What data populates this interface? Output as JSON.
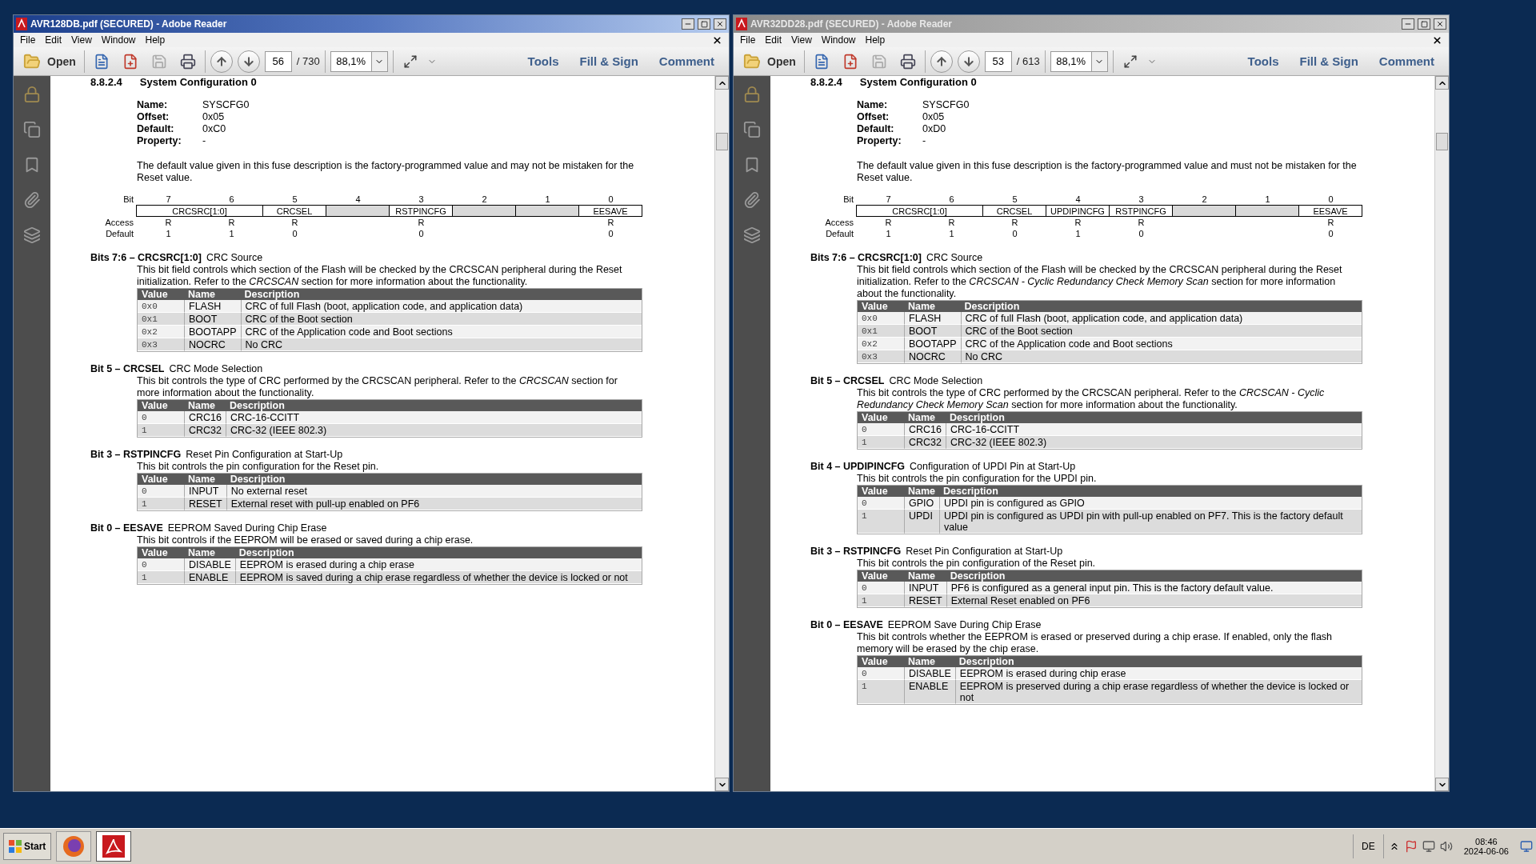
{
  "windows": [
    {
      "title": "AVR128DB.pdf (SECURED) - Adobe Reader",
      "active": true,
      "menu": [
        "File",
        "Edit",
        "View",
        "Window",
        "Help"
      ],
      "toolbar": {
        "open": "Open",
        "page": "56",
        "page_count": "/ 730",
        "zoom": "88,1%",
        "tools": "Tools",
        "fill_sign": "Fill & Sign",
        "comment": "Comment"
      },
      "document": {
        "section_number": "8.8.2.4",
        "section_title": "System Configuration 0",
        "properties": [
          {
            "label": "Name:",
            "value": "SYSCFG0"
          },
          {
            "label": "Offset:",
            "value": "0x05"
          },
          {
            "label": "Default:",
            "value": "0xC0"
          },
          {
            "label": "Property:",
            "value": "-"
          }
        ],
        "note": "The default value given in this fuse description is the factory-programmed value and may not be mistaken for the Reset value.",
        "register": {
          "bit_label": "Bit",
          "access_label": "Access",
          "default_label": "Default",
          "bits": [
            {
              "number": "7",
              "access": "R",
              "default": "1"
            },
            {
              "number": "6",
              "access": "R",
              "default": "1"
            },
            {
              "number": "5",
              "access": "R",
              "default": "0"
            },
            {
              "number": "4"
            },
            {
              "number": "3",
              "access": "R",
              "default": "0"
            },
            {
              "number": "2"
            },
            {
              "number": "1"
            },
            {
              "number": "0",
              "access": "R",
              "default": "0"
            }
          ],
          "fields": [
            {
              "kind": "field",
              "name": "CRCSRC[1:0]",
              "wide": true
            },
            {
              "kind": "field",
              "name": "CRCSEL",
              "wide": false
            },
            {
              "kind": "reserved",
              "wide": false
            },
            {
              "kind": "field",
              "name": "RSTPINCFG",
              "wide": false
            },
            {
              "kind": "reserved",
              "wide": false
            },
            {
              "kind": "reserved",
              "wide": false
            },
            {
              "kind": "field",
              "name": "EESAVE",
              "wide": false
            }
          ]
        },
        "sections": [
          {
            "label": "Bits 7:6 – CRCSRC[1:0]",
            "title": "CRC Source",
            "paragraph": "This bit field controls which section of the Flash will be checked by the CRCSCAN peripheral during the Reset initialization. Refer to the *CRCSCAN* section for more information about the functionality.",
            "columns": [
              "Value",
              "Name",
              "Description"
            ],
            "rows": [
              [
                "0x0",
                "FLASH",
                "CRC of full Flash (boot, application code, and application data)"
              ],
              [
                "0x1",
                "BOOT",
                "CRC of the Boot section"
              ],
              [
                "0x2",
                "BOOTAPP",
                "CRC of the Application code and Boot sections"
              ],
              [
                "0x3",
                "NOCRC",
                "No CRC"
              ]
            ]
          },
          {
            "label": "Bit 5 – CRCSEL",
            "title": "CRC Mode Selection",
            "paragraph": "This bit controls the type of CRC performed by the CRCSCAN peripheral. Refer to the *CRCSCAN* section for more information about the functionality.",
            "columns": [
              "Value",
              "Name",
              "Description"
            ],
            "rows": [
              [
                "0",
                "CRC16",
                "CRC-16-CCITT"
              ],
              [
                "1",
                "CRC32",
                "CRC-32 (IEEE 802.3)"
              ]
            ]
          },
          {
            "label": "Bit 3 – RSTPINCFG",
            "title": "Reset Pin Configuration at Start-Up",
            "paragraph": "This bit controls the pin configuration for the Reset pin.",
            "columns": [
              "Value",
              "Name",
              "Description"
            ],
            "rows": [
              [
                "0",
                "INPUT",
                "No external reset"
              ],
              [
                "1",
                "RESET",
                "External reset with pull-up enabled on PF6"
              ]
            ]
          },
          {
            "label": "Bit 0 – EESAVE",
            "title": "EEPROM Saved During Chip Erase",
            "paragraph": "This bit controls if the EEPROM will be erased or saved during a chip erase.",
            "columns": [
              "Value",
              "Name",
              "Description"
            ],
            "rows": [
              [
                "0",
                "DISABLE",
                "EEPROM is erased during a chip erase"
              ],
              [
                "1",
                "ENABLE",
                "EEPROM is saved during a chip erase regardless of whether the device is locked or not"
              ]
            ]
          }
        ]
      }
    },
    {
      "title": "AVR32DD28.pdf (SECURED) - Adobe Reader",
      "active": false,
      "menu": [
        "File",
        "Edit",
        "View",
        "Window",
        "Help"
      ],
      "toolbar": {
        "open": "Open",
        "page": "53",
        "page_count": "/ 613",
        "zoom": "88,1%",
        "tools": "Tools",
        "fill_sign": "Fill & Sign",
        "comment": "Comment"
      },
      "document": {
        "section_number": "8.8.2.4",
        "section_title": "System Configuration 0",
        "properties": [
          {
            "label": "Name:",
            "value": "SYSCFG0"
          },
          {
            "label": "Offset:",
            "value": "0x05"
          },
          {
            "label": "Default:",
            "value": "0xD0"
          },
          {
            "label": "Property:",
            "value": "-"
          }
        ],
        "note": "The default value given in this fuse description is the factory-programmed value and must not be mistaken for the Reset value.",
        "register": {
          "bit_label": "Bit",
          "access_label": "Access",
          "default_label": "Default",
          "bits": [
            {
              "number": "7",
              "access": "R",
              "default": "1"
            },
            {
              "number": "6",
              "access": "R",
              "default": "1"
            },
            {
              "number": "5",
              "access": "R",
              "default": "0"
            },
            {
              "number": "4",
              "access": "R",
              "default": "1"
            },
            {
              "number": "3",
              "access": "R",
              "default": "0"
            },
            {
              "number": "2"
            },
            {
              "number": "1"
            },
            {
              "number": "0",
              "access": "R",
              "default": "0"
            }
          ],
          "fields": [
            {
              "kind": "field",
              "name": "CRCSRC[1:0]",
              "wide": true
            },
            {
              "kind": "field",
              "name": "CRCSEL",
              "wide": false
            },
            {
              "kind": "field",
              "name": "UPDIPINCFG",
              "wide": false
            },
            {
              "kind": "field",
              "name": "RSTPINCFG",
              "wide": false
            },
            {
              "kind": "reserved",
              "wide": false
            },
            {
              "kind": "reserved",
              "wide": false
            },
            {
              "kind": "field",
              "name": "EESAVE",
              "wide": false
            }
          ]
        },
        "sections": [
          {
            "label": "Bits 7:6 – CRCSRC[1:0]",
            "title": "CRC Source",
            "paragraph": "This bit field controls which section of the Flash will be checked by the CRCSCAN peripheral during the Reset initialization. Refer to the *CRCSCAN - Cyclic Redundancy Check Memory Scan* section for more information about the functionality.",
            "columns": [
              "Value",
              "Name",
              "Description"
            ],
            "rows": [
              [
                "0x0",
                "FLASH",
                "CRC of full Flash (boot, application code, and application data)"
              ],
              [
                "0x1",
                "BOOT",
                "CRC of the Boot section"
              ],
              [
                "0x2",
                "BOOTAPP",
                "CRC of the Application code and Boot sections"
              ],
              [
                "0x3",
                "NOCRC",
                "No CRC"
              ]
            ]
          },
          {
            "label": "Bit 5 – CRCSEL",
            "title": "CRC Mode Selection",
            "paragraph": "This bit controls the type of CRC performed by the CRCSCAN peripheral. Refer to the *CRCSCAN - Cyclic Redundancy Check Memory Scan* section for more information about the functionality.",
            "columns": [
              "Value",
              "Name",
              "Description"
            ],
            "rows": [
              [
                "0",
                "CRC16",
                "CRC-16-CCITT"
              ],
              [
                "1",
                "CRC32",
                "CRC-32 (IEEE 802.3)"
              ]
            ]
          },
          {
            "label": "Bit 4 – UPDIPINCFG",
            "title": "Configuration of UPDI Pin at Start-Up",
            "paragraph": "This bit controls the pin configuration for the UPDI pin.",
            "columns": [
              "Value",
              "Name",
              "Description"
            ],
            "rows": [
              [
                "0",
                "GPIO",
                "UPDI pin is configured as GPIO"
              ],
              [
                "1",
                "UPDI",
                "UPDI pin is configured as UPDI pin with pull-up enabled on PF7. This is the factory default value"
              ]
            ]
          },
          {
            "label": "Bit 3 – RSTPINCFG",
            "title": "Reset Pin Configuration at Start-Up",
            "paragraph": "This bit controls the pin configuration of the Reset pin.",
            "columns": [
              "Value",
              "Name",
              "Description"
            ],
            "rows": [
              [
                "0",
                "INPUT",
                "PF6 is configured as a general input pin. This is the factory default value."
              ],
              [
                "1",
                "RESET",
                "External Reset enabled on PF6"
              ]
            ]
          },
          {
            "label": "Bit 0 – EESAVE",
            "title": "EEPROM Save During Chip Erase",
            "paragraph": "This bit controls whether the EEPROM is erased or preserved during a chip erase. If enabled, only the flash memory will be erased by the chip erase.",
            "columns": [
              "Value",
              "Name",
              "Description"
            ],
            "rows": [
              [
                "0",
                "DISABLE",
                "EEPROM is erased during chip erase"
              ],
              [
                "1",
                "ENABLE",
                "EEPROM is preserved during a chip erase regardless of whether the device is locked or not"
              ]
            ]
          }
        ]
      }
    }
  ],
  "taskbar": {
    "start": "Start",
    "language": "DE",
    "time": "08:46",
    "date": "2024-06-06"
  }
}
